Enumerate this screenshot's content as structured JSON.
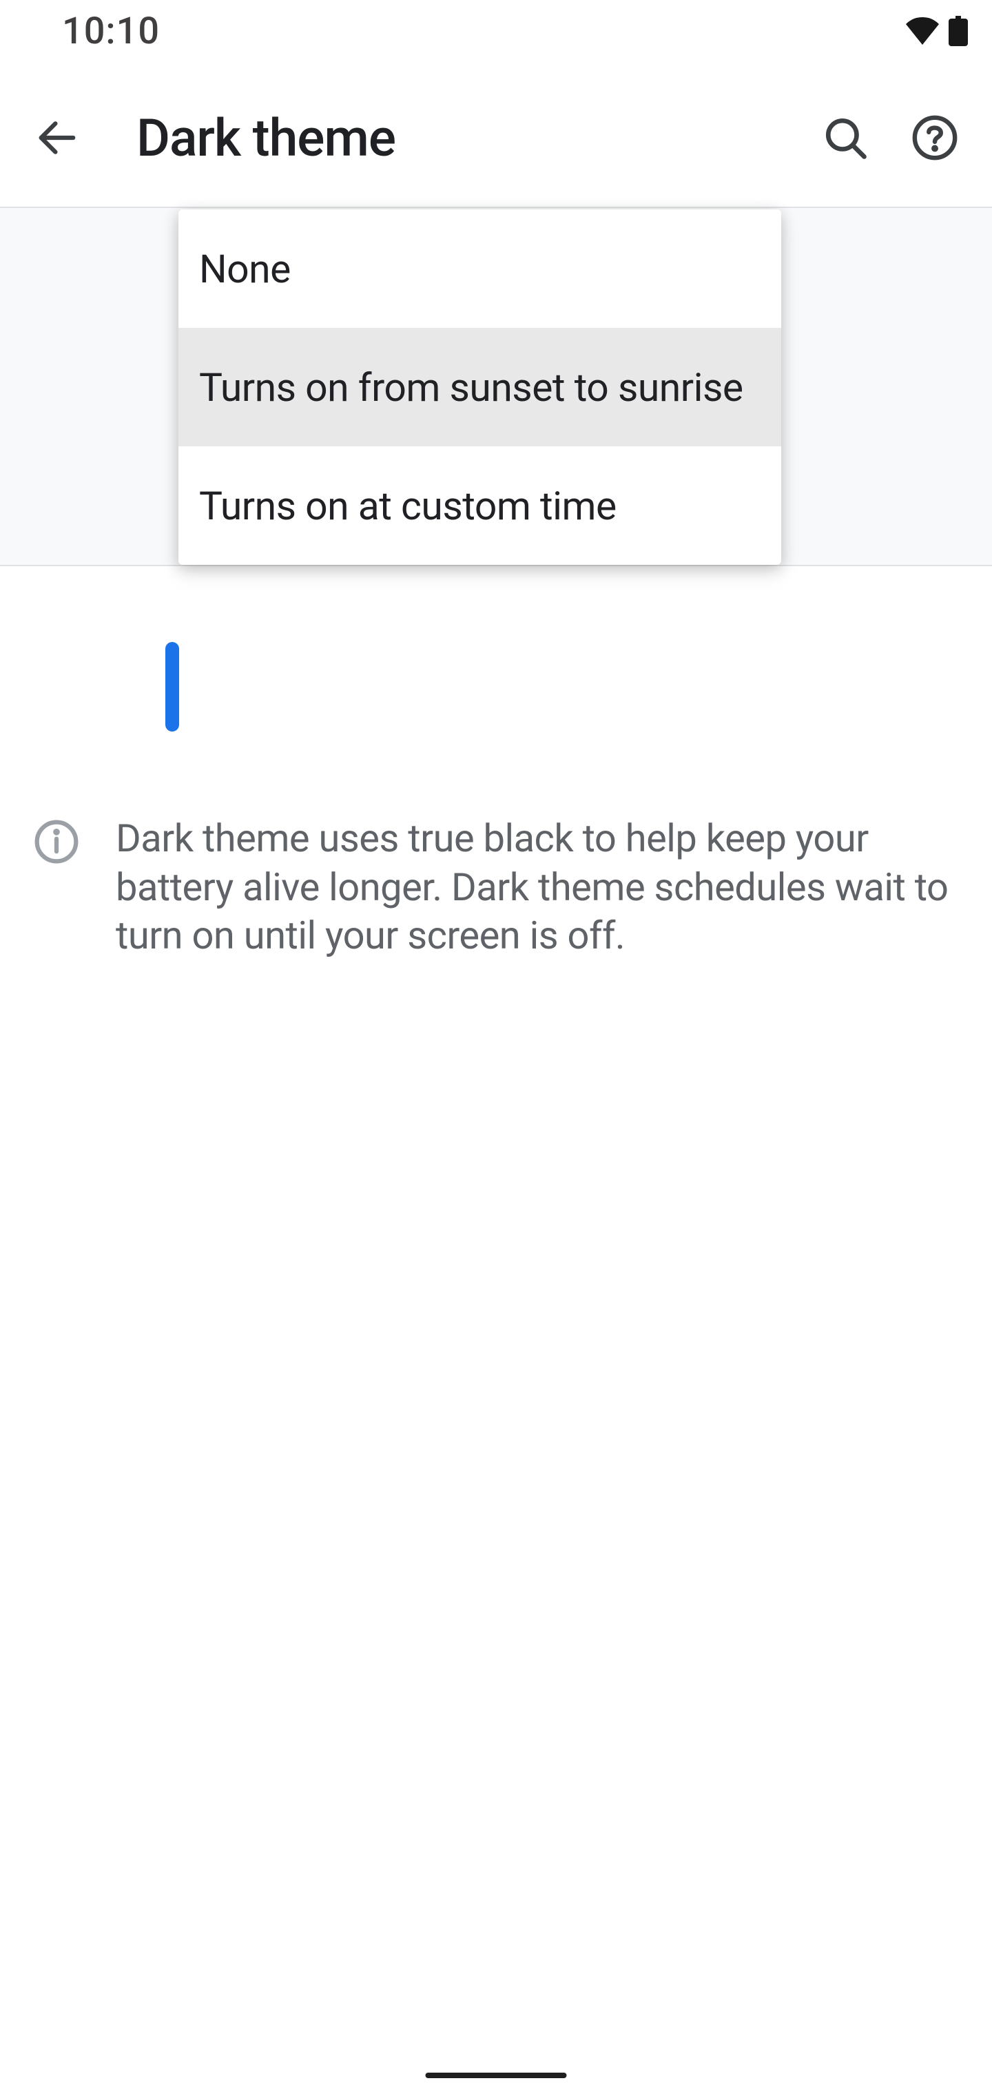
{
  "status": {
    "time": "10:10"
  },
  "header": {
    "title": "Dark theme"
  },
  "menu": {
    "items": [
      {
        "label": "None",
        "selected": false
      },
      {
        "label": "Turns on from sunset to sunrise",
        "selected": true
      },
      {
        "label": "Turns on at custom time",
        "selected": false
      }
    ]
  },
  "info": {
    "text": "Dark theme uses true black to help keep your battery alive longer. Dark theme schedules wait to turn on until your screen is off."
  }
}
